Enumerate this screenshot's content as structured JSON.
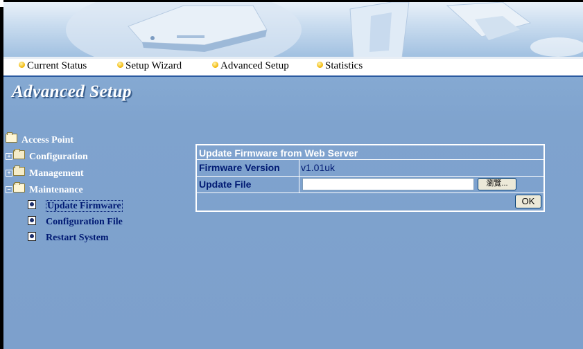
{
  "nav": {
    "items": [
      {
        "label": "Current Status"
      },
      {
        "label": "Setup Wizard"
      },
      {
        "label": "Advanced Setup"
      },
      {
        "label": "Statistics"
      }
    ]
  },
  "page": {
    "title": "Advanced Setup"
  },
  "tree": {
    "root": "Access Point",
    "configuration": "Configuration",
    "management": "Management",
    "maintenance": "Maintenance",
    "update_firmware": "Update Firmware",
    "configuration_file": "Configuration File",
    "restart_system": "Restart System"
  },
  "panel": {
    "header": "Update Firmware from Web Server",
    "firmware_version_label": "Firmware Version",
    "firmware_version_value": "v1.01uk",
    "update_file_label": "Update File",
    "update_file_value": "",
    "browse_label": "瀏覽...",
    "ok_label": "OK"
  },
  "colors": {
    "background": "#7fa3ce",
    "link": "#001a73",
    "nav_dot": "#f2b400"
  }
}
